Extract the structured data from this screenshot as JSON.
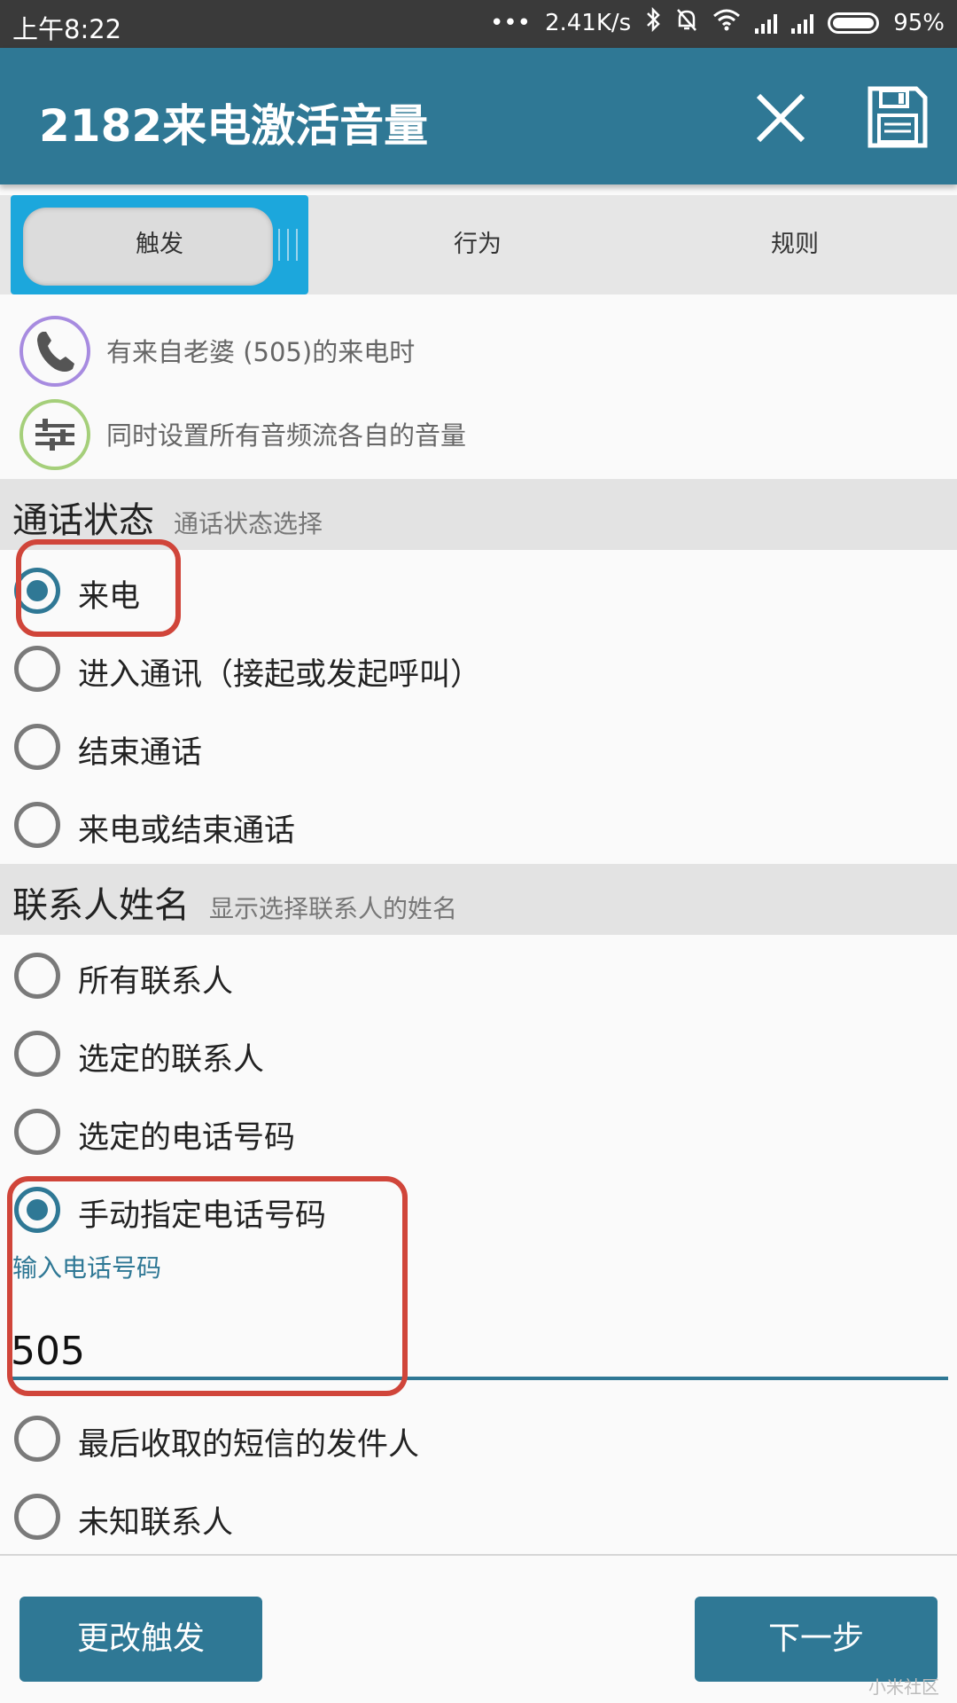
{
  "status_bar": {
    "time": "上午8:22",
    "dots": "•••",
    "speed": "2.41K/s",
    "battery": "95%"
  },
  "app_bar": {
    "title": "2182来电激活音量"
  },
  "tabs": [
    {
      "label": "触发"
    },
    {
      "label": "行为"
    },
    {
      "label": "规则"
    }
  ],
  "summary": [
    {
      "icon": "phone-icon",
      "text": "有来自老婆 (505)的来电时"
    },
    {
      "icon": "equalizer-icon",
      "text": "同时设置所有音频流各自的音量"
    }
  ],
  "call_state": {
    "title": "通话状态",
    "subtitle": "通话状态选择",
    "options": [
      {
        "label": "来电",
        "selected": true
      },
      {
        "label": "进入通讯（接起或发起呼叫）",
        "selected": false
      },
      {
        "label": "结束通话",
        "selected": false
      },
      {
        "label": "来电或结束通话",
        "selected": false
      }
    ]
  },
  "contact_name": {
    "title": "联系人姓名",
    "subtitle": "显示选择联系人的姓名",
    "options": [
      {
        "label": "所有联系人",
        "selected": false
      },
      {
        "label": "选定的联系人",
        "selected": false
      },
      {
        "label": "选定的电话号码",
        "selected": false
      },
      {
        "label": "手动指定电话号码",
        "selected": true
      },
      {
        "label": "最后收取的短信的发件人",
        "selected": false
      },
      {
        "label": "未知联系人",
        "selected": false
      }
    ],
    "phone_input": {
      "label": "输入电话号码",
      "value": "505"
    }
  },
  "buttons": {
    "change_trigger": "更改触发",
    "next": "下一步"
  },
  "watermark": "小米社区",
  "colors": {
    "primary": "#2f7895",
    "tab_highlight": "#1ca7dc",
    "annotation_red": "#d0453a"
  }
}
